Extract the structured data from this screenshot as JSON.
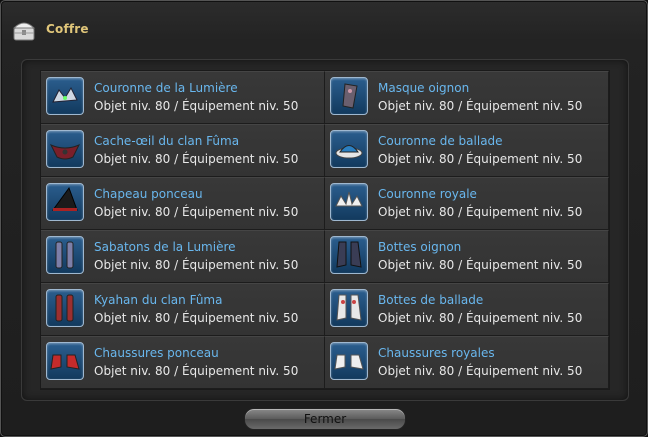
{
  "window": {
    "title": "Coffre"
  },
  "items": [
    {
      "name": "Couronne de la Lumière",
      "level": "Objet niv. 80 / Équipement niv. 50",
      "icon": "crown-icon"
    },
    {
      "name": "Masque oignon",
      "level": "Objet niv. 80 / Équipement niv. 50",
      "icon": "mask-icon"
    },
    {
      "name": "Cache-œil du clan Fûma",
      "level": "Objet niv. 80 / Équipement niv. 50",
      "icon": "eyepatch-icon"
    },
    {
      "name": "Couronne de ballade",
      "level": "Objet niv. 80 / Équipement niv. 50",
      "icon": "hat-icon"
    },
    {
      "name": "Chapeau ponceau",
      "level": "Objet niv. 80 / Équipement niv. 50",
      "icon": "pointed-hat-icon"
    },
    {
      "name": "Couronne royale",
      "level": "Objet niv. 80 / Équipement niv. 50",
      "icon": "crown-icon"
    },
    {
      "name": "Sabatons de la Lumière",
      "level": "Objet niv. 80 / Équipement niv. 50",
      "icon": "sabatons-icon"
    },
    {
      "name": "Bottes oignon",
      "level": "Objet niv. 80 / Équipement niv. 50",
      "icon": "boots-icon"
    },
    {
      "name": "Kyahan du clan Fûma",
      "level": "Objet niv. 80 / Équipement niv. 50",
      "icon": "leg-wraps-icon"
    },
    {
      "name": "Bottes de ballade",
      "level": "Objet niv. 80 / Équipement niv. 50",
      "icon": "boots-icon"
    },
    {
      "name": "Chaussures ponceau",
      "level": "Objet niv. 80 / Équipement niv. 50",
      "icon": "shoes-icon"
    },
    {
      "name": "Chaussures royales",
      "level": "Objet niv. 80 / Équipement niv. 50",
      "icon": "shoes-icon"
    }
  ],
  "footer": {
    "close_label": "Fermer"
  },
  "colors": {
    "title": "#e0c67a",
    "item_name": "#69b7ee",
    "item_level": "#e8e8e8",
    "icon_bg": "#1f4c78"
  }
}
